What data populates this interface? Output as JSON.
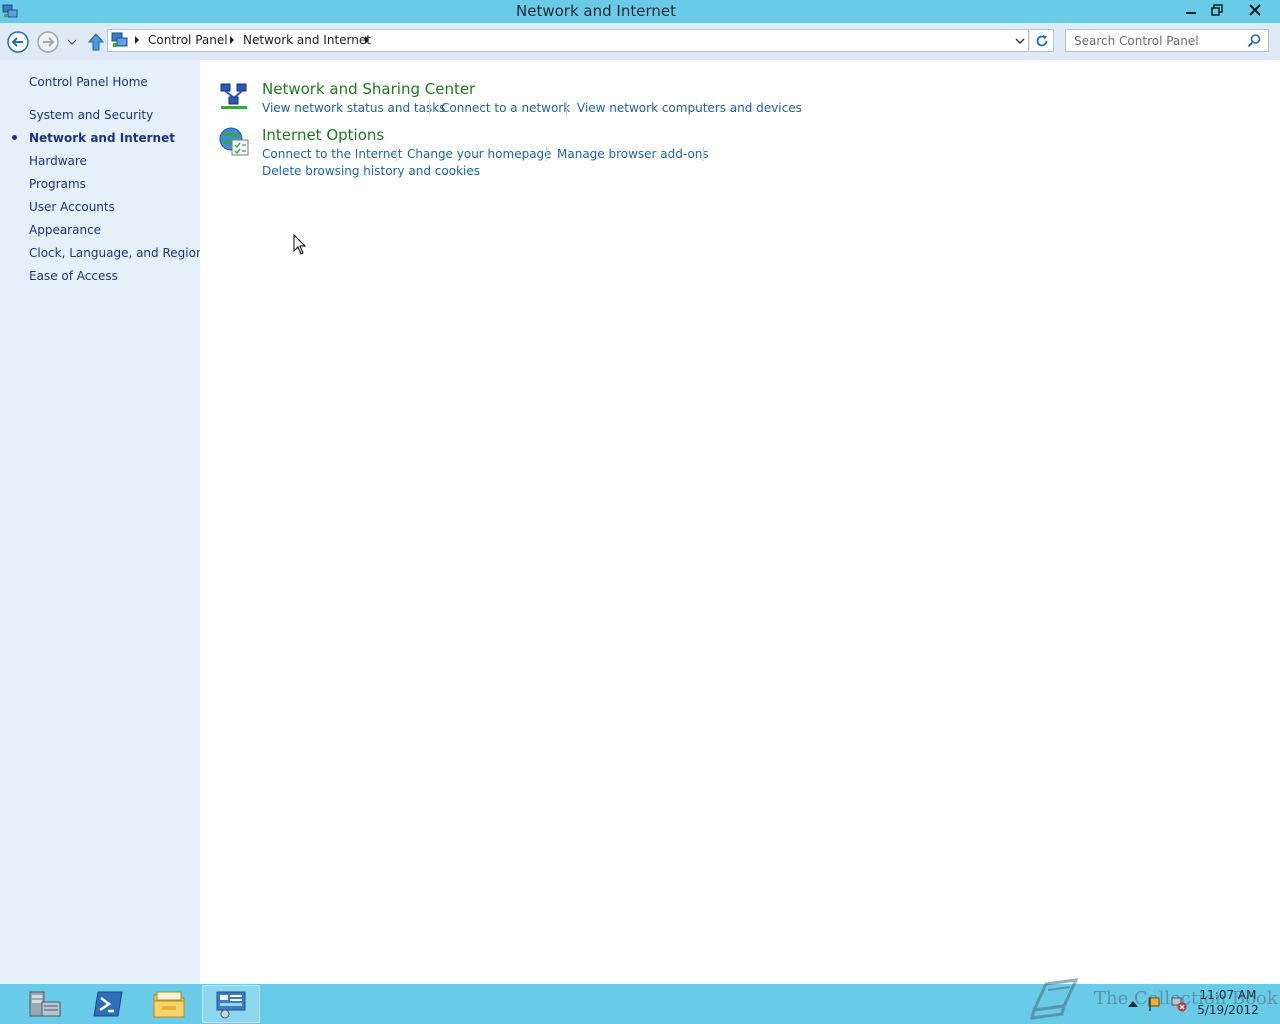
{
  "window": {
    "title": "Network and Internet"
  },
  "navigation": {
    "breadcrumbs": [
      "Control Panel",
      "Network and Internet"
    ],
    "search_placeholder": "Search Control Panel"
  },
  "sidebar": {
    "items": [
      {
        "label": "Control Panel Home",
        "active": false
      },
      {
        "label": "System and Security",
        "active": false
      },
      {
        "label": "Network and Internet",
        "active": true
      },
      {
        "label": "Hardware",
        "active": false
      },
      {
        "label": "Programs",
        "active": false
      },
      {
        "label": "User Accounts",
        "active": false
      },
      {
        "label": "Appearance",
        "active": false
      },
      {
        "label": "Clock, Language, and Region",
        "active": false
      },
      {
        "label": "Ease of Access",
        "active": false
      }
    ]
  },
  "categories": [
    {
      "title": "Network and Sharing Center",
      "icon": "network-sharing-icon",
      "links": [
        "View network status and tasks",
        "Connect to a network",
        "View network computers and devices"
      ]
    },
    {
      "title": "Internet Options",
      "icon": "internet-options-icon",
      "links": [
        "Connect to the Internet",
        "Change your homepage",
        "Manage browser add-ons",
        "Delete browsing history and cookies"
      ]
    }
  ],
  "taskbar": {
    "apps": [
      "server-manager-icon",
      "powershell-icon",
      "file-explorer-icon",
      "control-panel-icon"
    ],
    "watermark": "The Collection Book",
    "clock_time": "11:07 AM",
    "clock_date": "5/19/2012"
  },
  "colors": {
    "titlebar": "#6acbe9",
    "sidebar": "#e6f0fa",
    "link": "#1e64a0",
    "category_title": "#1e7a1e"
  }
}
